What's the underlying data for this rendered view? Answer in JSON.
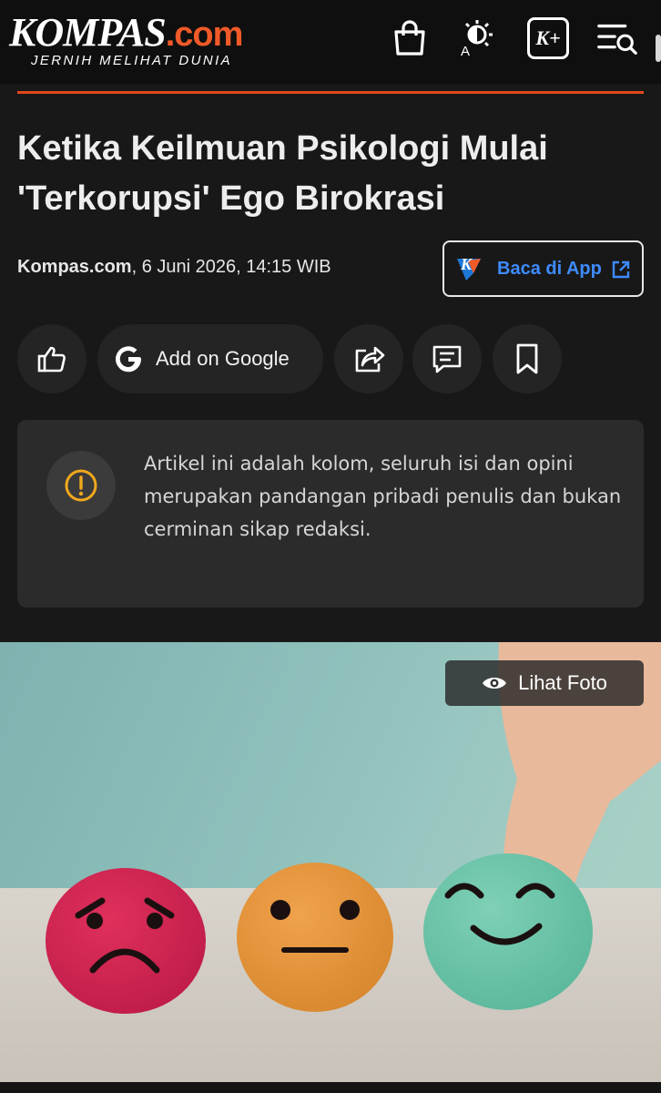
{
  "header": {
    "logo": {
      "brand": "KOMPAS",
      "domain": ".com",
      "tagline": "JERNIH MELIHAT DUNIA"
    },
    "icons": [
      "shopping-bag-icon",
      "theme-toggle-icon",
      "kompas-plus-icon",
      "menu-search-icon"
    ],
    "theme_icon_letter": "A",
    "kplus_label": "K+"
  },
  "article": {
    "title": "Ketika Keilmuan Psikologi Mulai 'Terkorupsi' Ego Birokrasi",
    "source": "Kompas.com",
    "date": ", 6 Juni 2026, 14:15 WIB",
    "app_button": {
      "label": "Baca di App",
      "logo_letter": "K"
    }
  },
  "actions": {
    "google_label": "Add on Google",
    "icons": [
      "like-icon",
      "google-icon",
      "share-icon",
      "comment-icon",
      "bookmark-icon"
    ]
  },
  "notice": {
    "text": "Artikel ini adalah kolom, seluruh isi dan opini merupakan pandangan pribadi penulis dan bukan cerminan sikap redaksi."
  },
  "hero": {
    "button_label": "Lihat Foto",
    "icon": "eye-icon"
  },
  "colors": {
    "background": "#181818",
    "accent": "#e0481c",
    "brand_orange": "#f05a28",
    "link_blue": "#3e8bff",
    "warning": "#f2a81d"
  }
}
